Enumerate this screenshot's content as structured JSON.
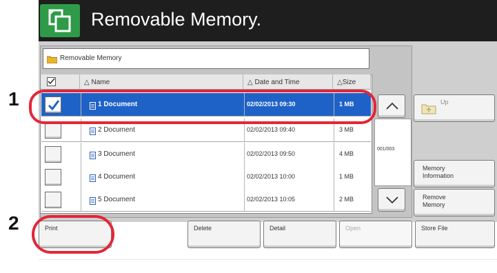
{
  "header": {
    "title": "Removable Memory.",
    "icon": "copy-pages-icon",
    "accent_color": "#2f9a48"
  },
  "path_bar": {
    "label": "Removable Memory",
    "icon": "folder-icon"
  },
  "columns": {
    "name": "△ Name",
    "date": "△ Date and Time",
    "size": "△Size"
  },
  "rows": [
    {
      "name": "1  Document",
      "date": "02/02/2013 09:30",
      "size": "1  MB",
      "selected": true
    },
    {
      "name": "2  Document",
      "date": "02/02/2013 09:40",
      "size": "3  MB",
      "selected": false
    },
    {
      "name": "3  Document",
      "date": "02/02/2013 09:50",
      "size": "4  MB",
      "selected": false
    },
    {
      "name": "4  Document",
      "date": "02/02/2013 10:00",
      "size": "1  MB",
      "selected": false
    },
    {
      "name": "5  Document",
      "date": "02/02/2013 10:05",
      "size": "2  MB",
      "selected": false
    }
  ],
  "selection_color": "#1f62c7",
  "pager": {
    "label": "001/003",
    "up_icon": "chevron-up-icon",
    "down_icon": "chevron-down-icon"
  },
  "side_buttons": {
    "up": "Up",
    "memory_information": "Memory\nInformation",
    "remove_memory": "Remove\nMemory"
  },
  "bottom_buttons": {
    "print": "Print",
    "delete": "Delete",
    "detail": "Detail",
    "open": "Open",
    "store_file": "Store File"
  },
  "callouts": {
    "first": "1",
    "second": "2",
    "color": "#e32636"
  }
}
